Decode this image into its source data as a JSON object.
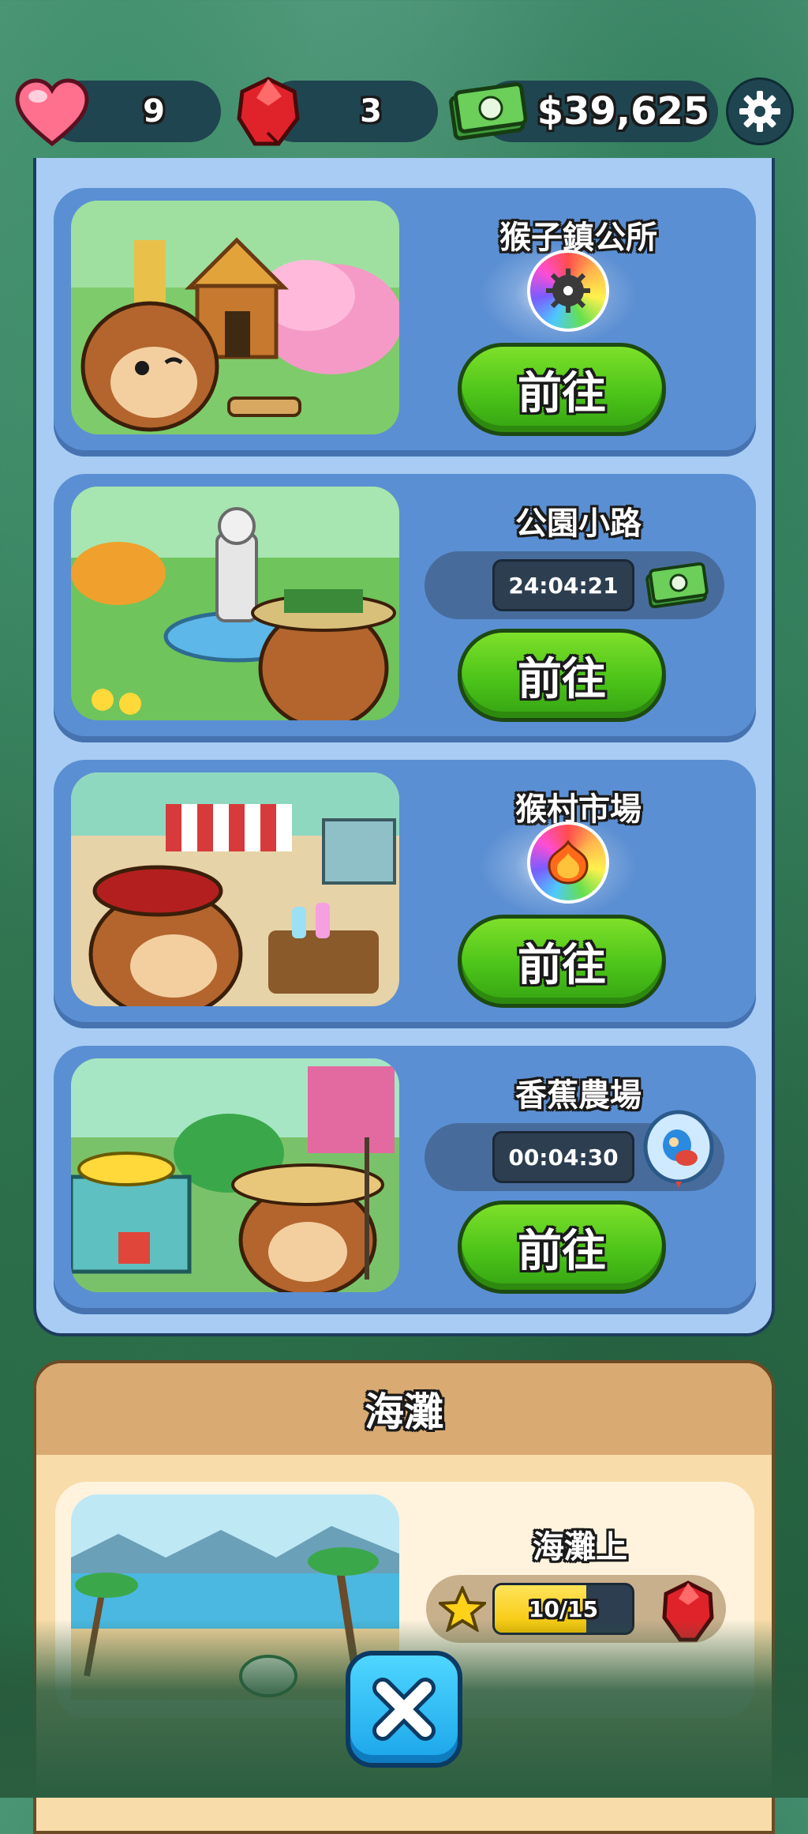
{
  "header": {
    "lives": "9",
    "gems": "3",
    "cash": "$39,625",
    "icons": [
      "heart-icon",
      "red-gem-icon",
      "cash-icon",
      "gear-icon"
    ]
  },
  "locations": [
    {
      "title": "猴子鎮公所",
      "reward": "rainbow-spiked-bloon-badge",
      "button": "前往"
    },
    {
      "title": "公園小路",
      "timer": "24:04:21",
      "reward": "cash-icon",
      "button": "前往"
    },
    {
      "title": "猴村市場",
      "reward": "phoenix-bloon-badge",
      "button": "前往"
    },
    {
      "title": "香蕉農場",
      "timer": "00:04:30",
      "reward": "monkey-hero-balloon",
      "button": "前往"
    }
  ],
  "beach": {
    "section_title": "海灘",
    "card_title": "海灘上",
    "progress_text": "10/15",
    "progress_fraction": 0.667
  },
  "colors": {
    "go_green": "#4cc419",
    "panel_blue": "#a8ccf3",
    "card_blue": "#5b8fd3",
    "beach_tan": "#d9ab72",
    "close_blue": "#1aa5ea"
  }
}
